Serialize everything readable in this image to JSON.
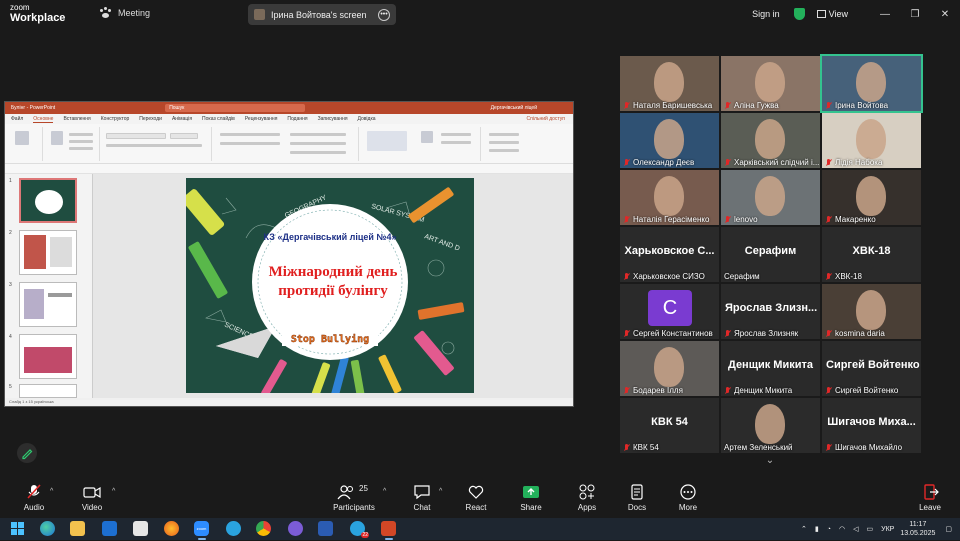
{
  "app": {
    "logo_top": "zoom",
    "logo_bottom": "Workplace",
    "meeting_label": "Meeting"
  },
  "share": {
    "label": "Ірина Войтова's screen"
  },
  "header": {
    "signin": "Sign in",
    "view": "View"
  },
  "powerpoint": {
    "title": "Булінг - PowerPoint",
    "search": "Пошук",
    "user": "Дергачівський ліцей",
    "menu": [
      "Файл",
      "Основне",
      "Вставлення",
      "Конструктор",
      "Переходи",
      "Анімація",
      "Показ слайдів",
      "Рецензування",
      "Подання",
      "Записування",
      "Довідка"
    ],
    "share_btn": "Спільний доступ",
    "slide": {
      "school": "КЗ «Дергачівський ліцей №4»",
      "title_line1": "Міжнародний день",
      "title_line2": "протидії булінгу",
      "stamp": "Stop Bullying",
      "doodles": [
        "GEOGRAPHY",
        "SOLAR SYSTEM",
        "ART AND D",
        "SCIENCE"
      ]
    },
    "status": "Слайд 1 з 15     українська"
  },
  "participants": [
    {
      "name": "Наталя Баришевська",
      "type": "video",
      "bg": "#6b5a4c"
    },
    {
      "name": "Аліна Гужва",
      "type": "video",
      "bg": "#8a7466"
    },
    {
      "name": "Ірина Войтова",
      "type": "video",
      "bg": "#46617a",
      "active": true
    },
    {
      "name": "Олександр Деєв",
      "type": "video",
      "bg": "#2f5173"
    },
    {
      "name": "Харківський слідчий і...",
      "type": "video",
      "bg": "#5a5d55"
    },
    {
      "name": "Лідія Набока",
      "type": "video",
      "bg": "#d7cfc2"
    },
    {
      "name": "Наталія Герасіменко",
      "type": "video",
      "bg": "#775b4e"
    },
    {
      "name": "lenovo",
      "type": "video",
      "bg": "#6c7275"
    },
    {
      "name": "Макаренко",
      "type": "video",
      "bg": "#36302c"
    },
    {
      "name": "Харьковское СИЗО",
      "type": "name",
      "big": "Харьковское С..."
    },
    {
      "name": "Серафим",
      "type": "name",
      "big": "Серафим",
      "nomic": true
    },
    {
      "name": "ХВК-18",
      "type": "name",
      "big": "ХВК-18"
    },
    {
      "name": "Сергей Константинов",
      "type": "avatar",
      "initial": "С"
    },
    {
      "name": "Ярослав Злизняк",
      "type": "name",
      "big": "Ярослав Злизн..."
    },
    {
      "name": "kosmina daria",
      "type": "video",
      "bg": "#4a3f36"
    },
    {
      "name": "Бодарев Ілля",
      "type": "video",
      "bg": "#5d5a57"
    },
    {
      "name": "Денщик Микита",
      "type": "name",
      "big": "Денщик Микита"
    },
    {
      "name": "Сиргей Войтенко",
      "type": "name",
      "big": "Сиргей Войтенко"
    },
    {
      "name": "КВК 54",
      "type": "name",
      "big": "КВК 54"
    },
    {
      "name": "Артем Зеленський",
      "type": "video",
      "bg": "#2b2b2b",
      "nomic": true
    },
    {
      "name": "Шигачов Михайло",
      "type": "name",
      "big": "Шигачов Миха..."
    }
  ],
  "toolbar": {
    "audio": "Audio",
    "video": "Video",
    "participants": "Participants",
    "participants_count": "25",
    "chat": "Chat",
    "react": "React",
    "share": "Share",
    "apps": "Apps",
    "docs": "Docs",
    "more": "More",
    "leave": "Leave"
  },
  "taskbar": {
    "lang": "УКР",
    "time": "11:17",
    "date": "13.05.2025",
    "badge_telegram": "22"
  }
}
